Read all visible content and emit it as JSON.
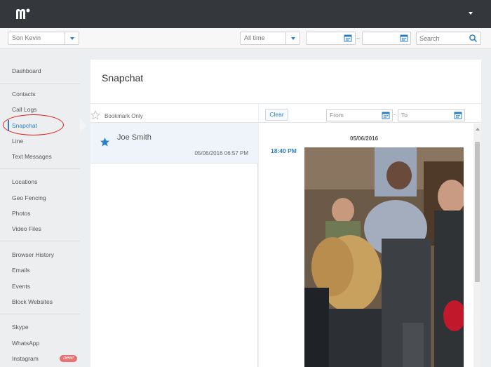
{
  "header": {
    "logo_icon": "mspy-logo-icon",
    "menu_icon": "caret-down-icon"
  },
  "filters": {
    "device_selected": "Son Kevin",
    "range_selected": "All time",
    "date_from": "",
    "date_to": "",
    "date_separator": "–",
    "search_placeholder": "Search"
  },
  "sidebar": {
    "groups": [
      [
        {
          "label": "Dashboard"
        }
      ],
      [
        {
          "label": "Contacts"
        },
        {
          "label": "Call Logs"
        },
        {
          "label": "Snapchat",
          "active": true
        },
        {
          "label": "Line"
        },
        {
          "label": "Text Messages"
        }
      ],
      [
        {
          "label": "Locations"
        },
        {
          "label": "Geo Fencing"
        },
        {
          "label": "Photos"
        },
        {
          "label": "Video Files"
        }
      ],
      [
        {
          "label": "Browser History"
        },
        {
          "label": "Emails"
        },
        {
          "label": "Events"
        },
        {
          "label": "Block Websites"
        }
      ],
      [
        {
          "label": "Skype"
        },
        {
          "label": "WhatsApp"
        },
        {
          "label": "Instagram",
          "badge": "new!"
        }
      ]
    ]
  },
  "main": {
    "title": "Snapchat",
    "bookmark_label": "Bookmark Only",
    "messages": [
      {
        "name": "Joe Smith",
        "datetime": "05/06/2016 06:57 PM",
        "starred": true
      }
    ],
    "detail": {
      "clear_label": "Clear",
      "from_placeholder": "From",
      "to_placeholder": "To",
      "range_separator": "-",
      "date_heading": "05/06/2016",
      "entries": [
        {
          "time": "18:40 PM",
          "type": "photo"
        }
      ]
    }
  },
  "colors": {
    "accent": "#2d7fc1",
    "topbar": "#34373c",
    "badge": "#e57373",
    "highlight": "#e02020"
  }
}
